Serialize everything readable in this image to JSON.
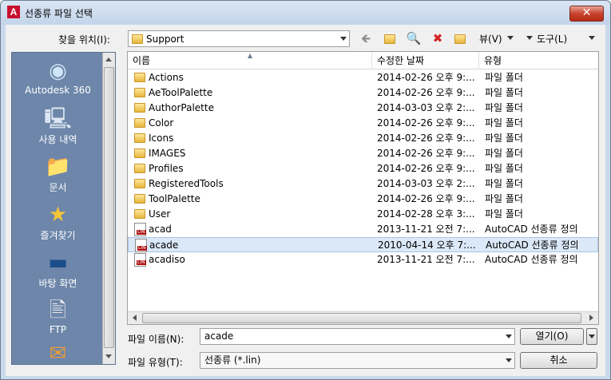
{
  "window": {
    "title": "선종류 파일 선택",
    "close": "✕"
  },
  "toolbar": {
    "lookin_label": "찾을 위치(I):",
    "lookin_value": "Support",
    "view_menu": "뷰(V)",
    "tools_menu": "도구(L)"
  },
  "places": [
    {
      "label": "Autodesk 360",
      "icon": "cloud-icon"
    },
    {
      "label": "사용 내역",
      "icon": "history-icon"
    },
    {
      "label": "문서",
      "icon": "documents-icon"
    },
    {
      "label": "즐겨찾기",
      "icon": "favorites-icon"
    },
    {
      "label": "바탕 화면",
      "icon": "desktop-icon"
    },
    {
      "label": "FTP",
      "icon": "ftp-icon"
    }
  ],
  "columns": {
    "name": "이름",
    "date": "수정한 날짜",
    "type": "유형"
  },
  "files": [
    {
      "name": "Actions",
      "date": "2014-02-26 오후 9:...",
      "type": "파일 폴더",
      "kind": "folder"
    },
    {
      "name": "AeToolPalette",
      "date": "2014-02-26 오후 9:...",
      "type": "파일 폴더",
      "kind": "folder"
    },
    {
      "name": "AuthorPalette",
      "date": "2014-03-03 오후 2:...",
      "type": "파일 폴더",
      "kind": "folder"
    },
    {
      "name": "Color",
      "date": "2014-02-26 오후 9:...",
      "type": "파일 폴더",
      "kind": "folder"
    },
    {
      "name": "Icons",
      "date": "2014-02-26 오후 9:...",
      "type": "파일 폴더",
      "kind": "folder"
    },
    {
      "name": "IMAGES",
      "date": "2014-02-26 오후 9:...",
      "type": "파일 폴더",
      "kind": "folder"
    },
    {
      "name": "Profiles",
      "date": "2014-02-26 오후 9:...",
      "type": "파일 폴더",
      "kind": "folder"
    },
    {
      "name": "RegisteredTools",
      "date": "2014-03-03 오후 2:...",
      "type": "파일 폴더",
      "kind": "folder"
    },
    {
      "name": "ToolPalette",
      "date": "2014-02-26 오후 9:...",
      "type": "파일 폴더",
      "kind": "folder"
    },
    {
      "name": "User",
      "date": "2014-02-28 오후 3:...",
      "type": "파일 폴더",
      "kind": "folder"
    },
    {
      "name": "acad",
      "date": "2013-11-21 오전 7:...",
      "type": "AutoCAD 선종류 정의",
      "kind": "lin"
    },
    {
      "name": "acade",
      "date": "2010-04-14 오후 7:...",
      "type": "AutoCAD 선종류 정의",
      "kind": "lin",
      "selected": true
    },
    {
      "name": "acadiso",
      "date": "2013-11-21 오전 7:...",
      "type": "AutoCAD 선종류 정의",
      "kind": "lin"
    }
  ],
  "bottom": {
    "filename_label": "파일 이름(N):",
    "filename_value": "acade",
    "filetype_label": "파일 유형(T):",
    "filetype_value": "선종류 (*.lin)",
    "open_button": "열기(O)",
    "cancel_button": "취소"
  }
}
